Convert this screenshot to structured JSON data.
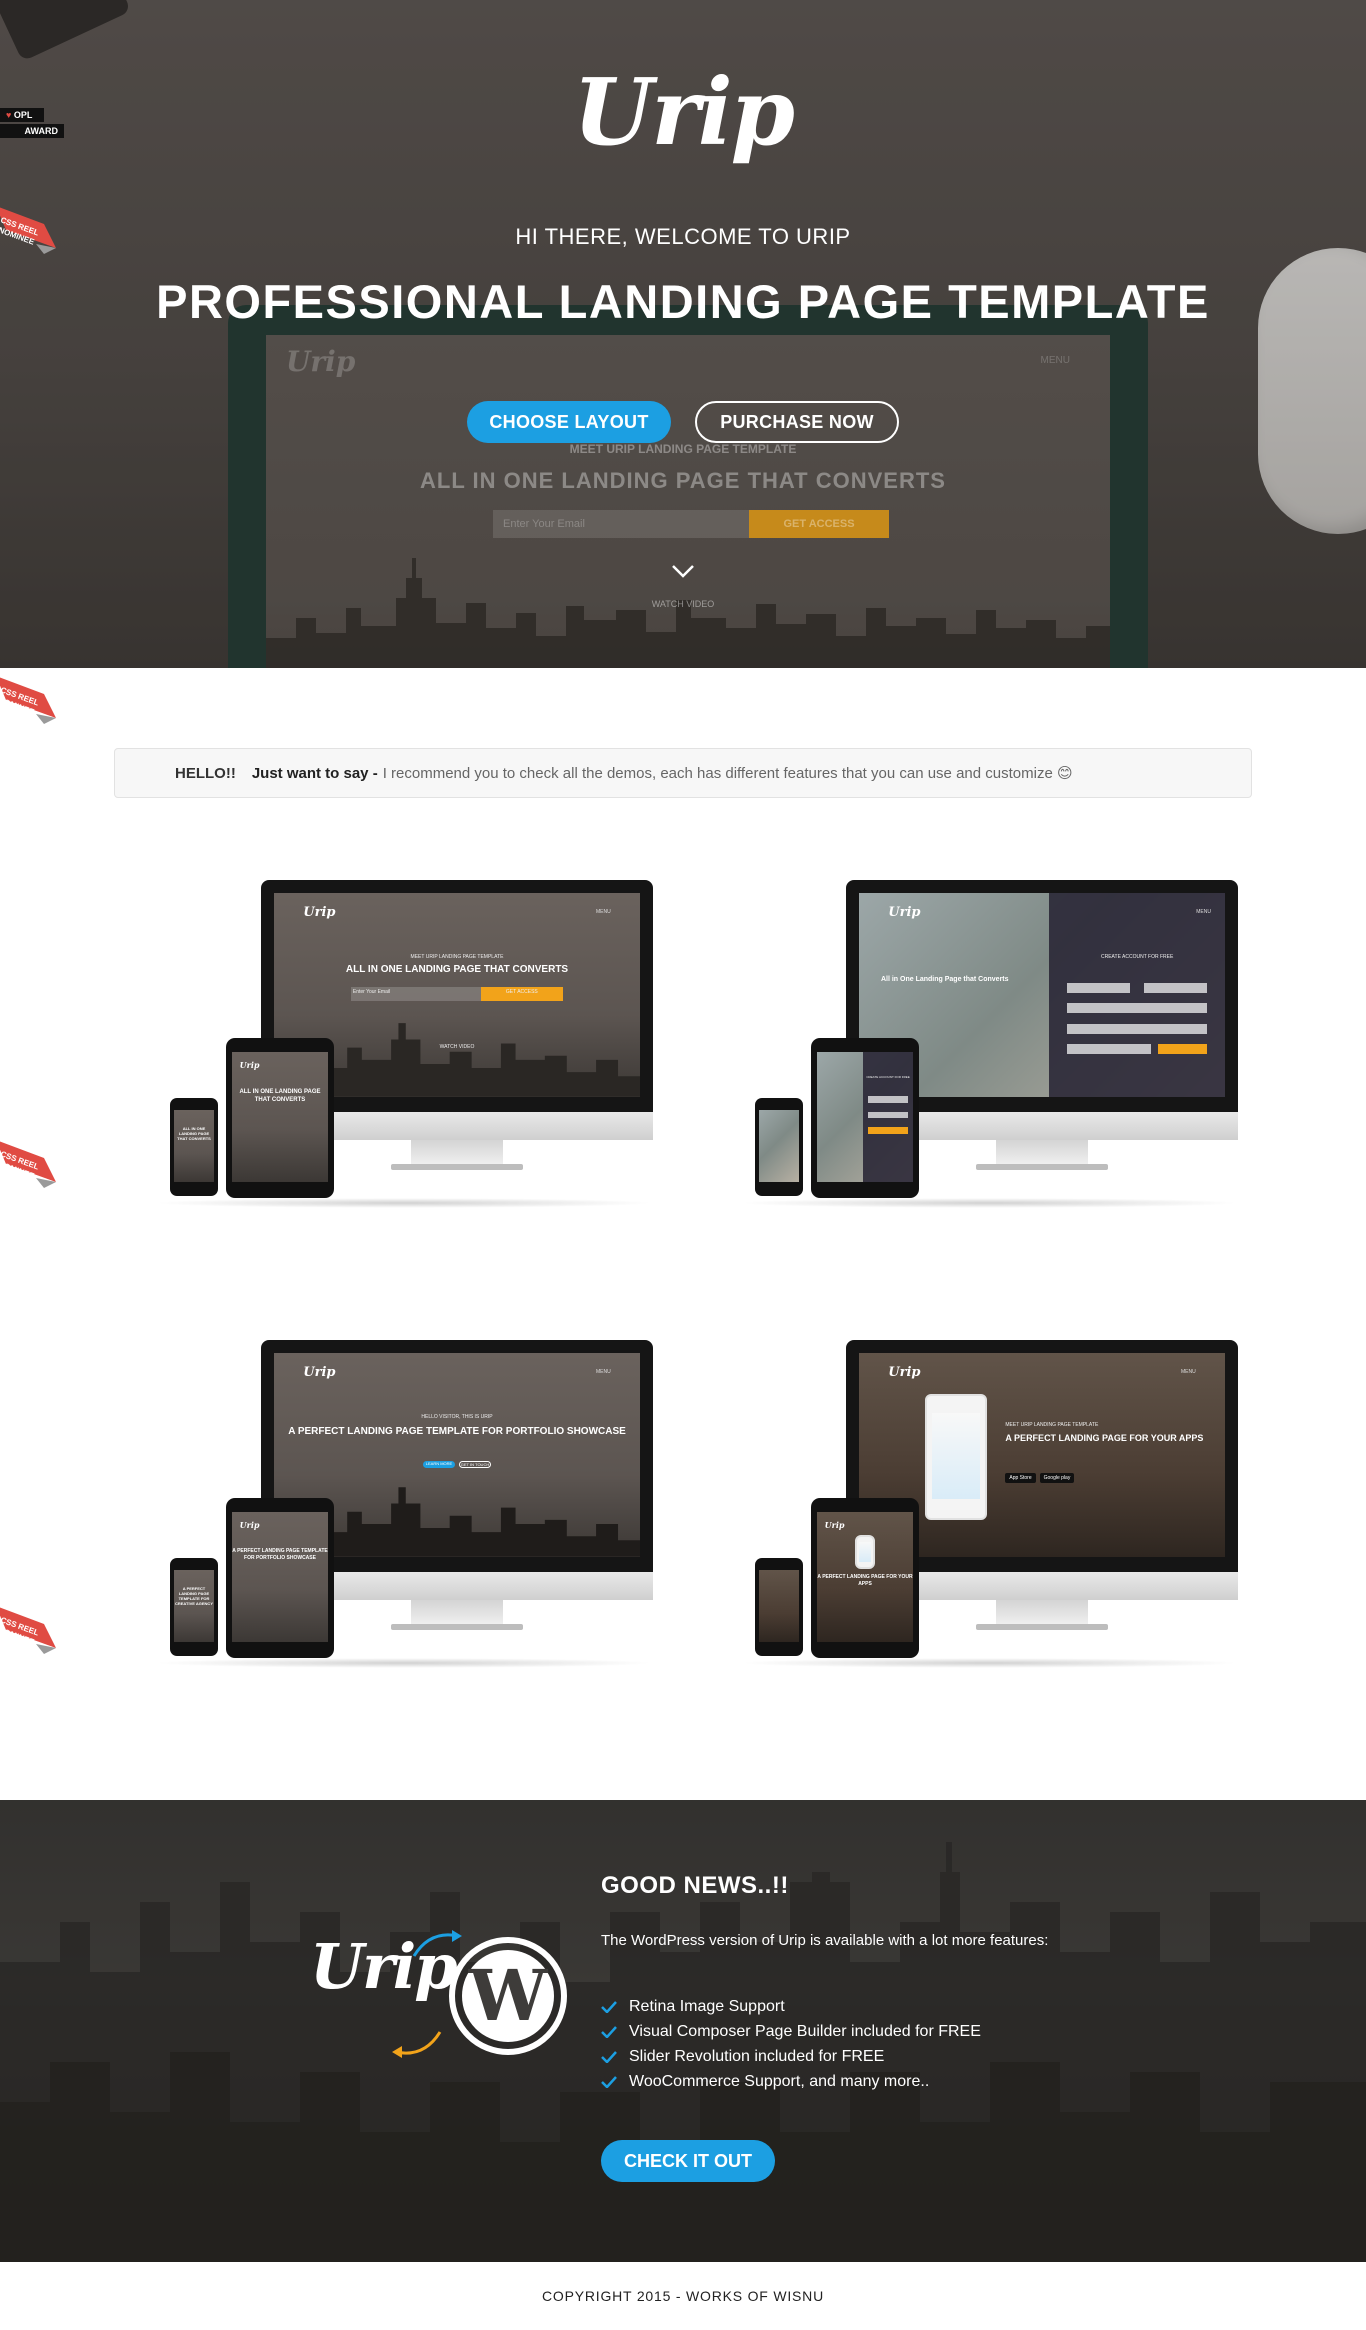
{
  "hero": {
    "logo": "Urip",
    "subtitle": "HI THERE, WELCOME TO URIP",
    "title": "PROFESSIONAL LANDING PAGE TEMPLATE",
    "primary_button": "CHOOSE LAYOUT",
    "secondary_button": "PURCHASE NOW",
    "background_logo": "Urip",
    "background_menu": "MENU",
    "background_small": "MEET URIP LANDING PAGE TEMPLATE",
    "background_big": "ALL IN ONE LANDING PAGE THAT CONVERTS",
    "background_input": "Enter Your Email",
    "background_button": "GET ACCESS",
    "background_watch": "WATCH VIDEO",
    "scroll_icon": "chevron-down-icon"
  },
  "badges": {
    "award_line1": "OPL",
    "award_line2": "AWARD",
    "ribbon_line1": "CSS REEL",
    "ribbon_line2": "NOMINEE"
  },
  "notice": {
    "hello": "HELLO!!",
    "lead": "Just want to say -",
    "message": "I recommend you to check all the demos, each has different features that you can use and customize 😊"
  },
  "demos": [
    {
      "logo": "Urip",
      "menu": "MENU",
      "small": "MEET URIP LANDING PAGE TEMPLATE",
      "headline": "ALL IN ONE LANDING PAGE THAT CONVERTS",
      "input": "Enter Your Email",
      "button": "GET ACCESS",
      "watch": "WATCH VIDEO",
      "tablet_headline": "ALL IN ONE LANDING PAGE THAT CONVERTS",
      "phone_headline": "ALL IN ONE LANDING PAGE THAT CONVERTS"
    },
    {
      "logo": "Urip",
      "menu": "MENU",
      "headline": "All in One Landing Page that Converts",
      "panel_title": "CREATE ACCOUNT FOR FREE",
      "tablet_panel_title": "CREATE ACCOUNT FOR FREE"
    },
    {
      "logo": "Urip",
      "menu": "MENU",
      "small": "HELLO VISITOR, THIS IS URIP",
      "headline": "A PERFECT LANDING PAGE TEMPLATE FOR PORTFOLIO SHOWCASE",
      "button1": "LEARN MORE",
      "button2": "GET IN TOUCH",
      "tablet_headline": "A PERFECT LANDING PAGE TEMPLATE FOR PORTFOLIO SHOWCASE",
      "phone_headline": "A PERFECT LANDING PAGE TEMPLATE FOR CREATIVE AGENCY"
    },
    {
      "logo": "Urip",
      "menu": "MENU",
      "small": "MEET URIP LANDING PAGE TEMPLATE",
      "headline": "A PERFECT LANDING PAGE FOR YOUR APPS",
      "store1": "App Store",
      "store2": "Google play",
      "tablet_headline": "A PERFECT LANDING PAGE FOR YOUR APPS"
    }
  ],
  "news": {
    "title": "GOOD NEWS..!!",
    "intro": "The WordPress version of Urip is available with a lot more features:",
    "features": [
      "Retina Image Support",
      "Visual Composer Page Builder included for FREE",
      "Slider Revolution included for FREE",
      "WooCommerce Support, and many more.."
    ],
    "button": "CHECK IT OUT",
    "logo": "Urip",
    "wordpress_icon": "wordpress-logo-icon"
  },
  "footer": {
    "copyright": "COPYRIGHT 2015 - WORKS OF WISNU"
  },
  "colors": {
    "accent_blue": "#1c9fe2",
    "accent_orange": "#f2a31a",
    "ribbon_red": "#e04b43"
  }
}
